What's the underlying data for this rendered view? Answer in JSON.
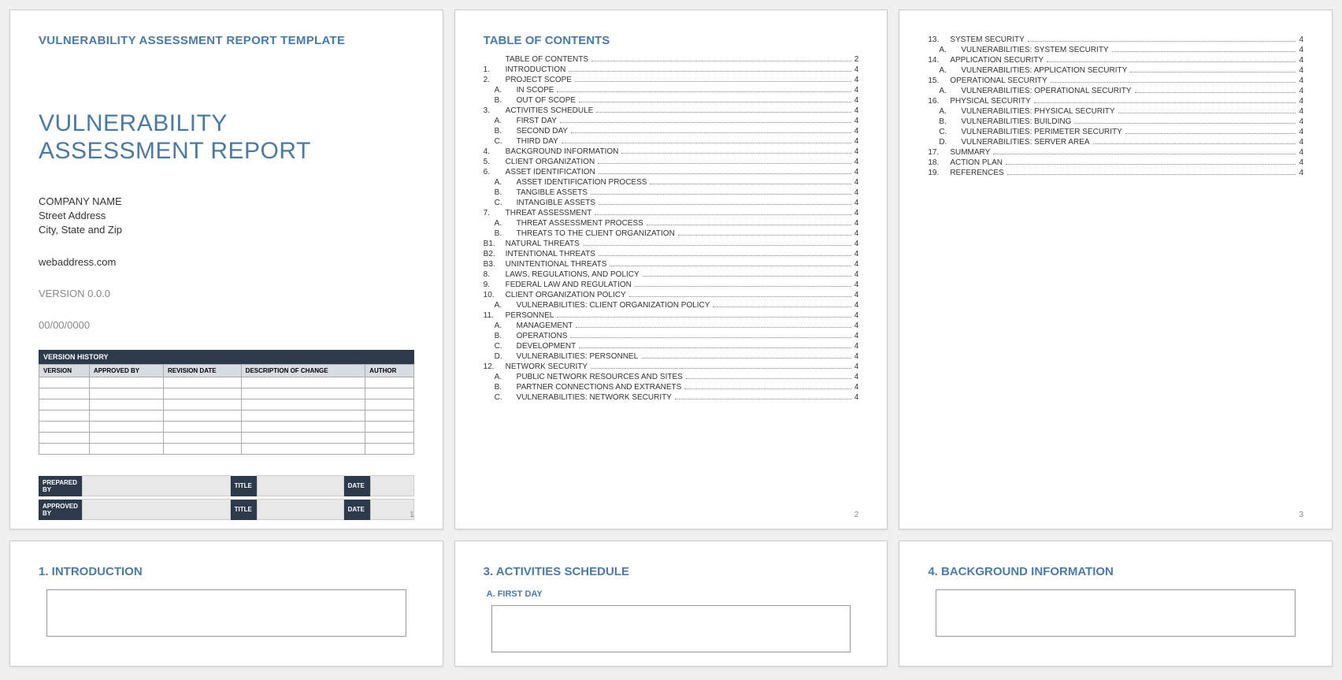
{
  "templateTag": "VULNERABILITY ASSESSMENT REPORT TEMPLATE",
  "mainTitle": "VULNERABILITY\nASSESSMENT REPORT",
  "company": {
    "name": "COMPANY NAME",
    "street": "Street Address",
    "cityline": "City, State and Zip",
    "web": "webaddress.com"
  },
  "version": "VERSION 0.0.0",
  "date": "00/00/0000",
  "vhHeader": "VERSION HISTORY",
  "vhCols": [
    "VERSION",
    "APPROVED BY",
    "REVISION DATE",
    "DESCRIPTION OF CHANGE",
    "AUTHOR"
  ],
  "sign": {
    "prepared": "PREPARED BY",
    "approved": "APPROVED BY",
    "title": "TITLE",
    "date": "DATE"
  },
  "tocTitle": "TABLE OF CONTENTS",
  "toc2": [
    {
      "n": "",
      "t": "TABLE OF CONTENTS",
      "p": "2",
      "i": 0
    },
    {
      "n": "1.",
      "t": "INTRODUCTION",
      "p": "4",
      "i": 0
    },
    {
      "n": "2.",
      "t": "PROJECT SCOPE",
      "p": "4",
      "i": 0
    },
    {
      "n": "A.",
      "t": "IN SCOPE",
      "p": "4",
      "i": 1
    },
    {
      "n": "B.",
      "t": "OUT OF SCOPE",
      "p": "4",
      "i": 1
    },
    {
      "n": "3.",
      "t": "ACTIVITIES SCHEDULE",
      "p": "4",
      "i": 0
    },
    {
      "n": "A.",
      "t": "FIRST DAY",
      "p": "4",
      "i": 1
    },
    {
      "n": "B.",
      "t": "SECOND DAY",
      "p": "4",
      "i": 1
    },
    {
      "n": "C.",
      "t": "THIRD DAY",
      "p": "4",
      "i": 1
    },
    {
      "n": "4.",
      "t": "BACKGROUND INFORMATION",
      "p": "4",
      "i": 0
    },
    {
      "n": "5.",
      "t": "CLIENT ORGANIZATION",
      "p": "4",
      "i": 0
    },
    {
      "n": "6.",
      "t": "ASSET IDENTIFICATION",
      "p": "4",
      "i": 0
    },
    {
      "n": "A.",
      "t": "ASSET IDENTIFICATION PROCESS",
      "p": "4",
      "i": 1
    },
    {
      "n": "B.",
      "t": "TANGIBLE ASSETS",
      "p": "4",
      "i": 1
    },
    {
      "n": "C.",
      "t": "INTANGIBLE ASSETS",
      "p": "4",
      "i": 1
    },
    {
      "n": "7.",
      "t": "THREAT ASSESSMENT",
      "p": "4",
      "i": 0
    },
    {
      "n": "A.",
      "t": "THREAT ASSESSMENT PROCESS",
      "p": "4",
      "i": 1
    },
    {
      "n": "B.",
      "t": "THREATS TO THE CLIENT ORGANIZATION",
      "p": "4",
      "i": 1
    },
    {
      "n": "B1.",
      "t": "NATURAL THREATS",
      "p": "4",
      "i": 0
    },
    {
      "n": "B2.",
      "t": "INTENTIONAL THREATS",
      "p": "4",
      "i": 0
    },
    {
      "n": "B3.",
      "t": "UNINTENTIONAL THREATS",
      "p": "4",
      "i": 0
    },
    {
      "n": "8.",
      "t": "LAWS, REGULATIONS, AND POLICY",
      "p": "4",
      "i": 0
    },
    {
      "n": "9.",
      "t": "FEDERAL LAW AND REGULATION",
      "p": "4",
      "i": 0
    },
    {
      "n": "10.",
      "t": "CLIENT ORGANIZATION POLICY",
      "p": "4",
      "i": 0
    },
    {
      "n": "A.",
      "t": "VULNERABILITIES: CLIENT ORGANIZATION POLICY",
      "p": "4",
      "i": 1
    },
    {
      "n": "11.",
      "t": "PERSONNEL",
      "p": "4",
      "i": 0
    },
    {
      "n": "A.",
      "t": "MANAGEMENT",
      "p": "4",
      "i": 1
    },
    {
      "n": "B.",
      "t": "OPERATIONS",
      "p": "4",
      "i": 1
    },
    {
      "n": "C.",
      "t": "DEVELOPMENT",
      "p": "4",
      "i": 1
    },
    {
      "n": "D.",
      "t": "VULNERABILITIES: PERSONNEL",
      "p": "4",
      "i": 1
    },
    {
      "n": "12.",
      "t": "NETWORK SECURITY",
      "p": "4",
      "i": 0
    },
    {
      "n": "A.",
      "t": "PUBLIC NETWORK RESOURCES AND SITES",
      "p": "4",
      "i": 1
    },
    {
      "n": "B.",
      "t": "PARTNER CONNECTIONS AND EXTRANETS",
      "p": "4",
      "i": 1
    },
    {
      "n": "C.",
      "t": "VULNERABILITIES: NETWORK SECURITY",
      "p": "4",
      "i": 1
    }
  ],
  "toc3": [
    {
      "n": "13.",
      "t": "SYSTEM SECURITY",
      "p": "4",
      "i": 0
    },
    {
      "n": "A.",
      "t": "VULNERABILITIES: SYSTEM SECURITY",
      "p": "4",
      "i": 1
    },
    {
      "n": "14.",
      "t": "APPLICATION SECURITY",
      "p": "4",
      "i": 0
    },
    {
      "n": "A.",
      "t": "VULNERABILITIES: APPLICATION SECURITY",
      "p": "4",
      "i": 1
    },
    {
      "n": "15.",
      "t": "OPERATIONAL SECURITY",
      "p": "4",
      "i": 0
    },
    {
      "n": "A.",
      "t": "VULNERABILITIES: OPERATIONAL SECURITY",
      "p": "4",
      "i": 1
    },
    {
      "n": "16.",
      "t": "PHYSICAL SECURITY",
      "p": "4",
      "i": 0
    },
    {
      "n": "A.",
      "t": "VULNERABILITIES: PHYSICAL SECURITY",
      "p": "4",
      "i": 1
    },
    {
      "n": "B.",
      "t": "VULNERABILITIES: BUILDING",
      "p": "4",
      "i": 1
    },
    {
      "n": "C.",
      "t": "VULNERABILITIES: PERIMETER SECURITY",
      "p": "4",
      "i": 1
    },
    {
      "n": "D.",
      "t": "VULNERABILITIES: SERVER AREA",
      "p": "4",
      "i": 1
    },
    {
      "n": "17.",
      "t": "SUMMARY",
      "p": "4",
      "i": 0
    },
    {
      "n": "18.",
      "t": "ACTION PLAN",
      "p": "4",
      "i": 0
    },
    {
      "n": "19.",
      "t": "REFERENCES",
      "p": "4",
      "i": 0
    }
  ],
  "pageNums": {
    "p1": "1",
    "p2": "2",
    "p3": "3"
  },
  "sections": {
    "intro": "1. INTRODUCTION",
    "activities": "3. ACTIVITIES SCHEDULE",
    "firstday": "A.  FIRST DAY",
    "background": "4. BACKGROUND INFORMATION"
  }
}
